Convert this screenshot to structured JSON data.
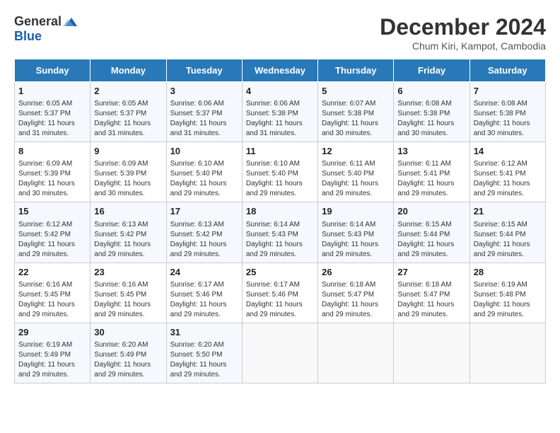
{
  "logo": {
    "general": "General",
    "blue": "Blue"
  },
  "title": {
    "month_year": "December 2024",
    "location": "Chum Kiri, Kampot, Cambodia"
  },
  "headers": [
    "Sunday",
    "Monday",
    "Tuesday",
    "Wednesday",
    "Thursday",
    "Friday",
    "Saturday"
  ],
  "weeks": [
    [
      {
        "day": "1",
        "info": "Sunrise: 6:05 AM\nSunset: 5:37 PM\nDaylight: 11 hours and 31 minutes."
      },
      {
        "day": "2",
        "info": "Sunrise: 6:05 AM\nSunset: 5:37 PM\nDaylight: 11 hours and 31 minutes."
      },
      {
        "day": "3",
        "info": "Sunrise: 6:06 AM\nSunset: 5:37 PM\nDaylight: 11 hours and 31 minutes."
      },
      {
        "day": "4",
        "info": "Sunrise: 6:06 AM\nSunset: 5:38 PM\nDaylight: 11 hours and 31 minutes."
      },
      {
        "day": "5",
        "info": "Sunrise: 6:07 AM\nSunset: 5:38 PM\nDaylight: 11 hours and 30 minutes."
      },
      {
        "day": "6",
        "info": "Sunrise: 6:08 AM\nSunset: 5:38 PM\nDaylight: 11 hours and 30 minutes."
      },
      {
        "day": "7",
        "info": "Sunrise: 6:08 AM\nSunset: 5:38 PM\nDaylight: 11 hours and 30 minutes."
      }
    ],
    [
      {
        "day": "8",
        "info": "Sunrise: 6:09 AM\nSunset: 5:39 PM\nDaylight: 11 hours and 30 minutes."
      },
      {
        "day": "9",
        "info": "Sunrise: 6:09 AM\nSunset: 5:39 PM\nDaylight: 11 hours and 30 minutes."
      },
      {
        "day": "10",
        "info": "Sunrise: 6:10 AM\nSunset: 5:40 PM\nDaylight: 11 hours and 29 minutes."
      },
      {
        "day": "11",
        "info": "Sunrise: 6:10 AM\nSunset: 5:40 PM\nDaylight: 11 hours and 29 minutes."
      },
      {
        "day": "12",
        "info": "Sunrise: 6:11 AM\nSunset: 5:40 PM\nDaylight: 11 hours and 29 minutes."
      },
      {
        "day": "13",
        "info": "Sunrise: 6:11 AM\nSunset: 5:41 PM\nDaylight: 11 hours and 29 minutes."
      },
      {
        "day": "14",
        "info": "Sunrise: 6:12 AM\nSunset: 5:41 PM\nDaylight: 11 hours and 29 minutes."
      }
    ],
    [
      {
        "day": "15",
        "info": "Sunrise: 6:12 AM\nSunset: 5:42 PM\nDaylight: 11 hours and 29 minutes."
      },
      {
        "day": "16",
        "info": "Sunrise: 6:13 AM\nSunset: 5:42 PM\nDaylight: 11 hours and 29 minutes."
      },
      {
        "day": "17",
        "info": "Sunrise: 6:13 AM\nSunset: 5:42 PM\nDaylight: 11 hours and 29 minutes."
      },
      {
        "day": "18",
        "info": "Sunrise: 6:14 AM\nSunset: 5:43 PM\nDaylight: 11 hours and 29 minutes."
      },
      {
        "day": "19",
        "info": "Sunrise: 6:14 AM\nSunset: 5:43 PM\nDaylight: 11 hours and 29 minutes."
      },
      {
        "day": "20",
        "info": "Sunrise: 6:15 AM\nSunset: 5:44 PM\nDaylight: 11 hours and 29 minutes."
      },
      {
        "day": "21",
        "info": "Sunrise: 6:15 AM\nSunset: 5:44 PM\nDaylight: 11 hours and 29 minutes."
      }
    ],
    [
      {
        "day": "22",
        "info": "Sunrise: 6:16 AM\nSunset: 5:45 PM\nDaylight: 11 hours and 29 minutes."
      },
      {
        "day": "23",
        "info": "Sunrise: 6:16 AM\nSunset: 5:45 PM\nDaylight: 11 hours and 29 minutes."
      },
      {
        "day": "24",
        "info": "Sunrise: 6:17 AM\nSunset: 5:46 PM\nDaylight: 11 hours and 29 minutes."
      },
      {
        "day": "25",
        "info": "Sunrise: 6:17 AM\nSunset: 5:46 PM\nDaylight: 11 hours and 29 minutes."
      },
      {
        "day": "26",
        "info": "Sunrise: 6:18 AM\nSunset: 5:47 PM\nDaylight: 11 hours and 29 minutes."
      },
      {
        "day": "27",
        "info": "Sunrise: 6:18 AM\nSunset: 5:47 PM\nDaylight: 11 hours and 29 minutes."
      },
      {
        "day": "28",
        "info": "Sunrise: 6:19 AM\nSunset: 5:48 PM\nDaylight: 11 hours and 29 minutes."
      }
    ],
    [
      {
        "day": "29",
        "info": "Sunrise: 6:19 AM\nSunset: 5:49 PM\nDaylight: 11 hours and 29 minutes."
      },
      {
        "day": "30",
        "info": "Sunrise: 6:20 AM\nSunset: 5:49 PM\nDaylight: 11 hours and 29 minutes."
      },
      {
        "day": "31",
        "info": "Sunrise: 6:20 AM\nSunset: 5:50 PM\nDaylight: 11 hours and 29 minutes."
      },
      {
        "day": "",
        "info": ""
      },
      {
        "day": "",
        "info": ""
      },
      {
        "day": "",
        "info": ""
      },
      {
        "day": "",
        "info": ""
      }
    ]
  ]
}
